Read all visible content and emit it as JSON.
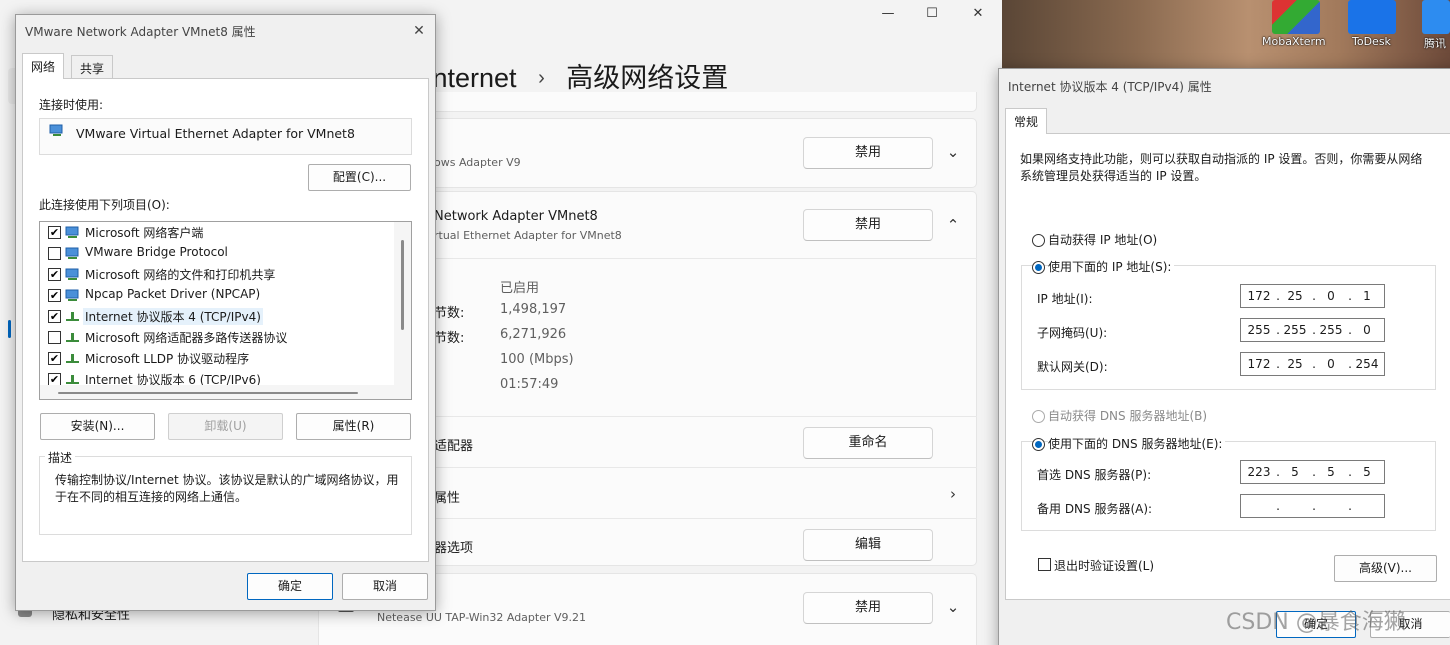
{
  "settings": {
    "minimize": "—",
    "maximize": "☐",
    "close": "✕",
    "title_prefix": "Internet",
    "separator": "›",
    "title": "高级网络设置",
    "adapter1_sub": "ows Adapter V9",
    "adapter1_button": "禁用",
    "adapter2_name": "Network Adapter VMnet8",
    "adapter2_sub": "rtual Ethernet Adapter for VMnet8",
    "adapter2_button": "禁用",
    "props": [
      {
        "label": "",
        "value": "已启用"
      },
      {
        "label": "节数:",
        "value": "1,498,197"
      },
      {
        "label": "节数:",
        "value": "6,271,926"
      },
      {
        "label": "",
        "value": "100 (Mbps)"
      },
      {
        "label": "",
        "value": "01:57:49"
      }
    ],
    "rename_label": "适配器",
    "rename_button": "重命名",
    "more_props_label": "属性",
    "options_label": "器选项",
    "edit_button": "编辑",
    "adapter3_name": "Netease UU TAP-Win32 Adapter V9.21",
    "adapter3_button": "禁用",
    "sidebar_privacy": "隐私和安全性"
  },
  "desktop": {
    "icons": [
      {
        "label": "MobaXterm",
        "icon": "mobaxterm-icon",
        "color": "#2b6cb0"
      },
      {
        "label": "ToDesk",
        "icon": "todesk-icon",
        "color": "#1a73e8"
      },
      {
        "label": "腾讯",
        "icon": "tencent-icon",
        "color": "#2d8cf0"
      }
    ]
  },
  "left_dialog": {
    "title": "VMware Network Adapter VMnet8 属性",
    "tabs": [
      "网络",
      "共享"
    ],
    "connect_using_label": "连接时使用:",
    "adapter_name": "VMware Virtual Ethernet Adapter for VMnet8",
    "configure_button": "配置(C)...",
    "items_label": "此连接使用下列项目(O):",
    "items": [
      {
        "checked": true,
        "label": "Microsoft 网络客户端",
        "icon": "network-client-icon"
      },
      {
        "checked": false,
        "label": "VMware Bridge Protocol",
        "icon": "network-client-icon"
      },
      {
        "checked": true,
        "label": "Microsoft 网络的文件和打印机共享",
        "icon": "network-client-icon"
      },
      {
        "checked": true,
        "label": "Npcap Packet Driver (NPCAP)",
        "icon": "network-client-icon"
      },
      {
        "checked": true,
        "label": "Internet 协议版本 4 (TCP/IPv4)",
        "icon": "protocol-icon",
        "selected": true
      },
      {
        "checked": false,
        "label": "Microsoft 网络适配器多路传送器协议",
        "icon": "protocol-icon"
      },
      {
        "checked": true,
        "label": "Microsoft LLDP 协议驱动程序",
        "icon": "protocol-icon"
      },
      {
        "checked": true,
        "label": "Internet 协议版本 6 (TCP/IPv6)",
        "icon": "protocol-icon"
      }
    ],
    "install_button": "安装(N)...",
    "uninstall_button": "卸载(U)",
    "properties_button": "属性(R)",
    "description_label": "描述",
    "description_text": "传输控制协议/Internet 协议。该协议是默认的广域网络协议，用于在不同的相互连接的网络上通信。",
    "ok_button": "确定",
    "cancel_button": "取消",
    "checkmark": "✔",
    "close": "✕"
  },
  "right_dialog": {
    "title": "Internet 协议版本 4 (TCP/IPv4) 属性",
    "tab": "常规",
    "intro": "如果网络支持此功能，则可以获取自动指派的 IP 设置。否则，你需要从网络系统管理员处获得适当的 IP 设置。",
    "auto_ip": "自动获得 IP 地址(O)",
    "manual_ip": "使用下面的 IP 地址(S):",
    "ip_label": "IP 地址(I):",
    "ip": [
      "172",
      "25",
      "0",
      "1"
    ],
    "mask_label": "子网掩码(U):",
    "mask": [
      "255",
      "255",
      "255",
      "0"
    ],
    "gateway_label": "默认网关(D):",
    "gateway": [
      "172",
      "25",
      "0",
      "254"
    ],
    "auto_dns": "自动获得 DNS 服务器地址(B)",
    "manual_dns": "使用下面的 DNS 服务器地址(E):",
    "pref_dns_label": "首选 DNS 服务器(P):",
    "pref_dns": [
      "223",
      "5",
      "5",
      "5"
    ],
    "alt_dns_label": "备用 DNS 服务器(A):",
    "alt_dns": [
      "",
      "",
      "",
      ""
    ],
    "validate_label": "退出时验证设置(L)",
    "advanced_button": "高级(V)...",
    "ok_button": "确定",
    "cancel_button": "取消",
    "dot": "."
  },
  "watermark": "CSDN @暴食海獭",
  "colors": {
    "accent": "#0067c0",
    "selected_row": "#e5f1fb"
  }
}
